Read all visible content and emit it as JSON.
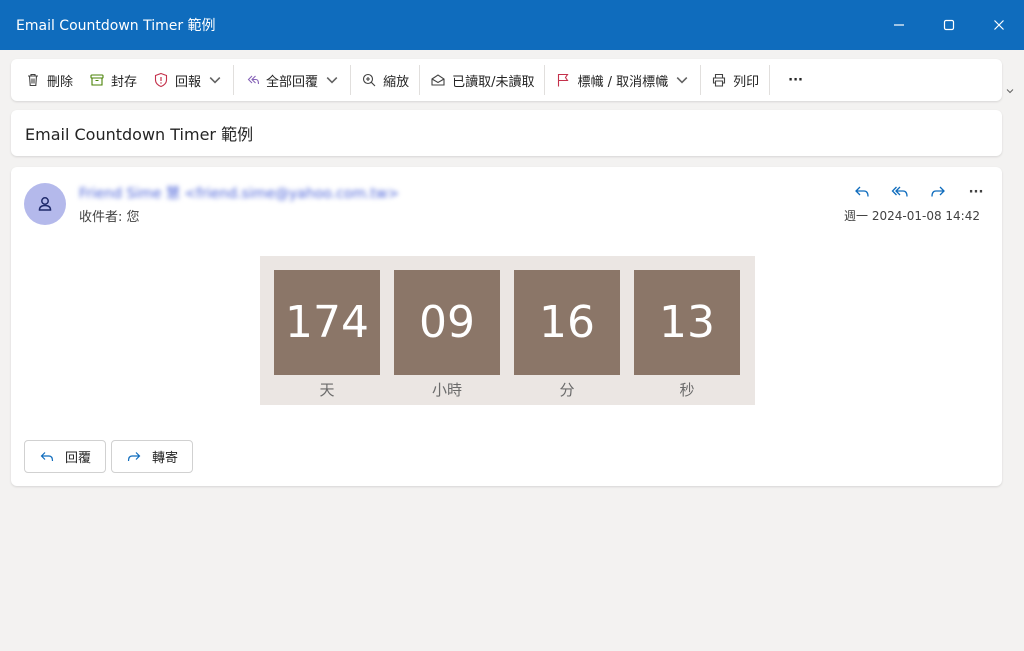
{
  "window": {
    "title": "Email Countdown Timer 範例"
  },
  "toolbar": {
    "delete": "刪除",
    "archive": "封存",
    "report": "回報",
    "reply_all": "全部回覆",
    "zoom": "縮放",
    "read_unread": "已讀取/未讀取",
    "flag": "標幟 / 取消標幟",
    "print": "列印",
    "more": "···"
  },
  "subject": "Email Countdown Timer 範例",
  "message": {
    "sender": "Friend Sime 慧 <friend.sime@yahoo.com.tw>",
    "recipient_label": "收件者:",
    "recipient": "您",
    "date": "週一 2024-01-08 14:42",
    "more": "···"
  },
  "countdown": {
    "days_value": "174",
    "hours_value": "09",
    "minutes_value": "16",
    "seconds_value": "13",
    "days_label": "天",
    "hours_label": "小時",
    "minutes_label": "分",
    "seconds_label": "秒"
  },
  "actions": {
    "reply": "回覆",
    "forward": "轉寄"
  },
  "colors": {
    "titlebar": "#0f6cbd",
    "tile": "#8b7668",
    "timer_bg": "#ebe6e3",
    "avatar": "#b4b9eb"
  }
}
